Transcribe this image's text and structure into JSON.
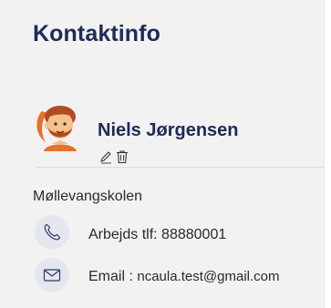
{
  "contact": {
    "title": "Kontaktinfo",
    "name": "Niels Jørgensen",
    "organization": "Møllevangskolen",
    "phone": {
      "label": "Arbejds tlf:",
      "value": "88880001",
      "icon": "phone-icon"
    },
    "email": {
      "label": "Email :",
      "value": "ncaula.test@gmail.com",
      "icon": "envelope-icon"
    },
    "actions": {
      "edit_icon": "pencil-icon",
      "delete_icon": "trash-icon"
    }
  },
  "colors": {
    "title": "#1f2a56",
    "panel_bg": "#f2f2f3",
    "icon_circle_bg": "#e4e8ee",
    "avatar_orange": "#e8702a"
  }
}
